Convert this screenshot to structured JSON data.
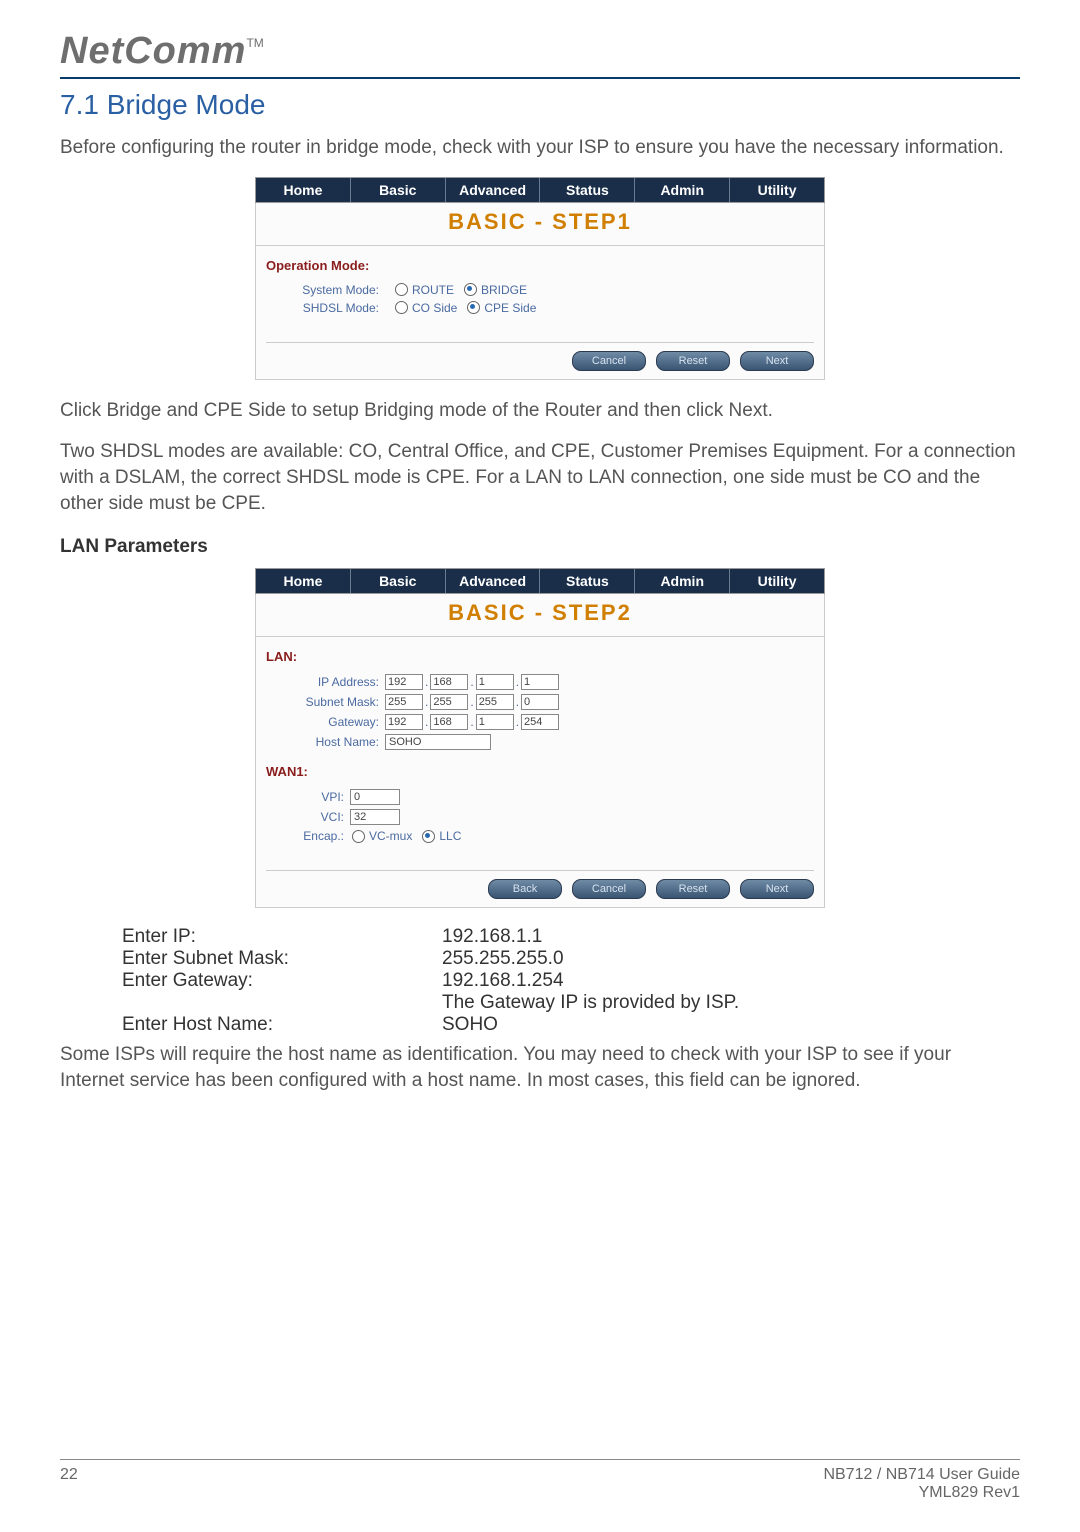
{
  "brand": "NetComm",
  "brand_tm": "TM",
  "section_title": "7.1 Bridge Mode",
  "intro": "Before configuring the router in bridge mode, check with your ISP to ensure you have the necessary information.",
  "tabs": [
    "Home",
    "Basic",
    "Advanced",
    "Status",
    "Admin",
    "Utility"
  ],
  "step1": {
    "header": "BASIC - STEP1",
    "group_label": "Operation Mode:",
    "system_mode_label": "System Mode:",
    "system_mode_options": [
      "ROUTE",
      "BRIDGE"
    ],
    "system_mode_selected": "BRIDGE",
    "shdsl_mode_label": "SHDSL Mode:",
    "shdsl_mode_options": [
      "CO Side",
      "CPE Side"
    ],
    "shdsl_mode_selected": "CPE Side",
    "buttons": [
      "Cancel",
      "Reset",
      "Next"
    ]
  },
  "para_after_step1_1": "Click Bridge and CPE Side to setup Bridging mode of the Router and then click Next.",
  "para_after_step1_2": "Two SHDSL modes are available: CO, Central Office, and CPE, Customer Premises Equipment. For a connection with a DSLAM, the correct SHDSL mode is CPE. For a LAN to LAN connection, one side must be CO and the other side must be CPE.",
  "lan_heading": "LAN Parameters",
  "step2": {
    "header": "BASIC - STEP2",
    "lan_label": "LAN:",
    "ip_label": "IP Address:",
    "ip": [
      "192",
      "168",
      "1",
      "1"
    ],
    "subnet_label": "Subnet Mask:",
    "subnet": [
      "255",
      "255",
      "255",
      "0"
    ],
    "gateway_label": "Gateway:",
    "gateway": [
      "192",
      "168",
      "1",
      "254"
    ],
    "hostname_label": "Host Name:",
    "hostname": "SOHO",
    "wan_label": "WAN1:",
    "vpi_label": "VPI:",
    "vpi": "0",
    "vci_label": "VCI:",
    "vci": "32",
    "encap_label": "Encap.:",
    "encap_options": [
      "VC-mux",
      "LLC"
    ],
    "encap_selected": "LLC",
    "buttons": [
      "Back",
      "Cancel",
      "Reset",
      "Next"
    ]
  },
  "info_rows": [
    {
      "label": "Enter IP:",
      "value": "192.168.1.1"
    },
    {
      "label": "Enter Subnet Mask:",
      "value": "255.255.255.0"
    },
    {
      "label": "Enter Gateway:",
      "value": "192.168.1.254"
    },
    {
      "label": "",
      "value": "The Gateway IP is provided by ISP."
    },
    {
      "label": "Enter Host Name:",
      "value": "SOHO"
    }
  ],
  "closing": "Some ISPs will require the host name as identification. You may need to check with your ISP to see if your Internet service has been configured with a host name. In most cases, this field can be ignored.",
  "footer": {
    "page": "22",
    "guide": "NB712 / NB714 User Guide",
    "rev": "YML829 Rev1"
  }
}
